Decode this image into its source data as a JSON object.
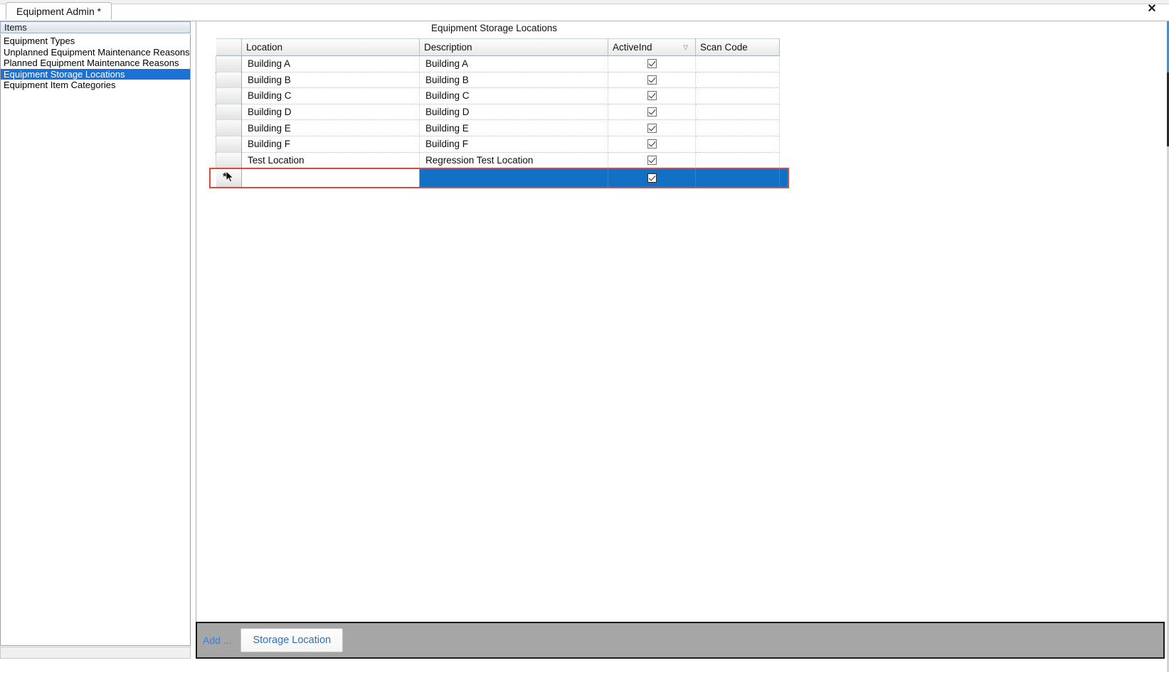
{
  "window": {
    "tab_label": "Equipment Admin *",
    "close_icon": "close-icon"
  },
  "sidebar": {
    "header": "Items",
    "items": [
      {
        "label": "Equipment Types",
        "selected": false
      },
      {
        "label": "Unplanned Equipment Maintenance Reasons",
        "selected": false
      },
      {
        "label": "Planned Equipment Maintenance Reasons",
        "selected": false
      },
      {
        "label": "Equipment Storage Locations",
        "selected": true
      },
      {
        "label": "Equipment Item Categories",
        "selected": false
      }
    ]
  },
  "grid": {
    "title": "Equipment Storage Locations",
    "columns": [
      {
        "key": "location",
        "label": "Location",
        "sorted": false
      },
      {
        "key": "description",
        "label": "Description",
        "sorted": false
      },
      {
        "key": "activeind",
        "label": "ActiveInd",
        "sorted": true,
        "sort_glyph": "▽"
      },
      {
        "key": "scancode",
        "label": "Scan Code",
        "sorted": false
      }
    ],
    "rows": [
      {
        "location": "Building A",
        "description": "Building A",
        "activeind": true,
        "scancode": ""
      },
      {
        "location": "Building B",
        "description": "Building B",
        "activeind": true,
        "scancode": ""
      },
      {
        "location": "Building C",
        "description": "Building C",
        "activeind": true,
        "scancode": ""
      },
      {
        "location": "Building D",
        "description": "Building D",
        "activeind": true,
        "scancode": ""
      },
      {
        "location": "Building E",
        "description": "Building E",
        "activeind": true,
        "scancode": ""
      },
      {
        "location": "Building F",
        "description": "Building F",
        "activeind": true,
        "scancode": ""
      },
      {
        "location": "Test Location",
        "description": "Regression Test Location",
        "activeind": true,
        "scancode": ""
      }
    ],
    "new_row": {
      "indicator": "*",
      "location": "",
      "description": "",
      "activeind": true,
      "scancode": "",
      "selected": true,
      "editing_column": "location"
    },
    "colors": {
      "selection_blue": "#1270c5",
      "focus_red": "#e0483c",
      "list_selection_blue": "#1b72d4"
    }
  },
  "toolbar": {
    "add_label": "Add ...",
    "storage_location_button": "Storage Location"
  }
}
